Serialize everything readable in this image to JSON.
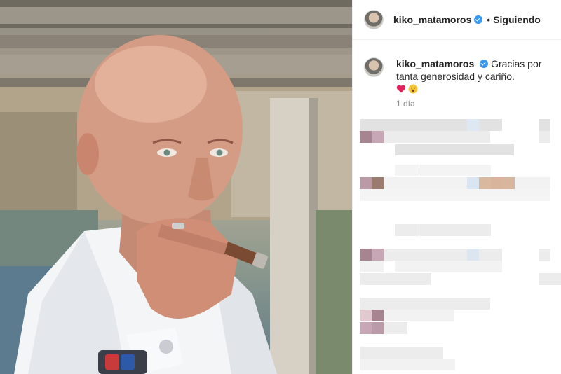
{
  "post": {
    "username": "kiko_matamoros",
    "follow_status": "Siguiendo",
    "separator": "•",
    "caption_text": "Gracias por tanta generosidad y cariño.",
    "emojis": [
      "heart-icon",
      "hushed-face-icon"
    ],
    "timestamp": "1 día"
  },
  "colors": {
    "verified": "#3897f0",
    "text": "#262626",
    "secondary_text": "#8e8e8e",
    "border": "#efefef"
  }
}
